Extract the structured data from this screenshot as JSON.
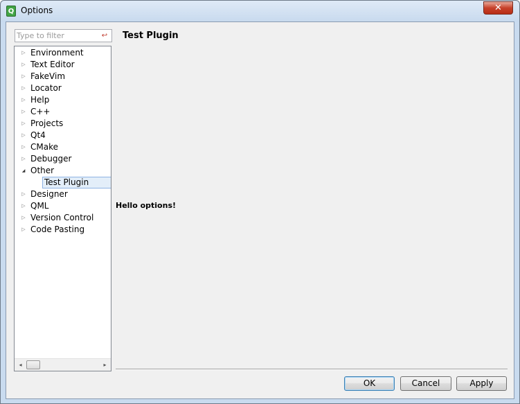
{
  "window": {
    "title": "Options",
    "app_icon_glyph": "Q",
    "close_glyph": "✕"
  },
  "filter": {
    "placeholder": "Type to filter",
    "clear_glyph": "↩"
  },
  "tree": {
    "items": [
      {
        "label": "Environment",
        "expanded": false
      },
      {
        "label": "Text Editor",
        "expanded": false
      },
      {
        "label": "FakeVim",
        "expanded": false
      },
      {
        "label": "Locator",
        "expanded": false
      },
      {
        "label": "Help",
        "expanded": false
      },
      {
        "label": "C++",
        "expanded": false
      },
      {
        "label": "Projects",
        "expanded": false
      },
      {
        "label": "Qt4",
        "expanded": false
      },
      {
        "label": "CMake",
        "expanded": false
      },
      {
        "label": "Debugger",
        "expanded": false
      },
      {
        "label": "Other",
        "expanded": true
      },
      {
        "label": "Designer",
        "expanded": false
      },
      {
        "label": "QML",
        "expanded": false
      },
      {
        "label": "Version Control",
        "expanded": false
      },
      {
        "label": "Code Pasting",
        "expanded": false
      }
    ],
    "selected_child": "Test Plugin",
    "collapsed_glyph": "▷",
    "expanded_glyph": "◢",
    "scroll_left_glyph": "◂",
    "scroll_right_glyph": "▸"
  },
  "page": {
    "title": "Test Plugin",
    "body": "Hello options!"
  },
  "buttons": {
    "ok": "OK",
    "cancel": "Cancel",
    "apply": "Apply"
  },
  "colors": {
    "selection_bg": "#e3eef9",
    "close_button": "#c7412a",
    "window_bg": "#f0f0f0"
  }
}
